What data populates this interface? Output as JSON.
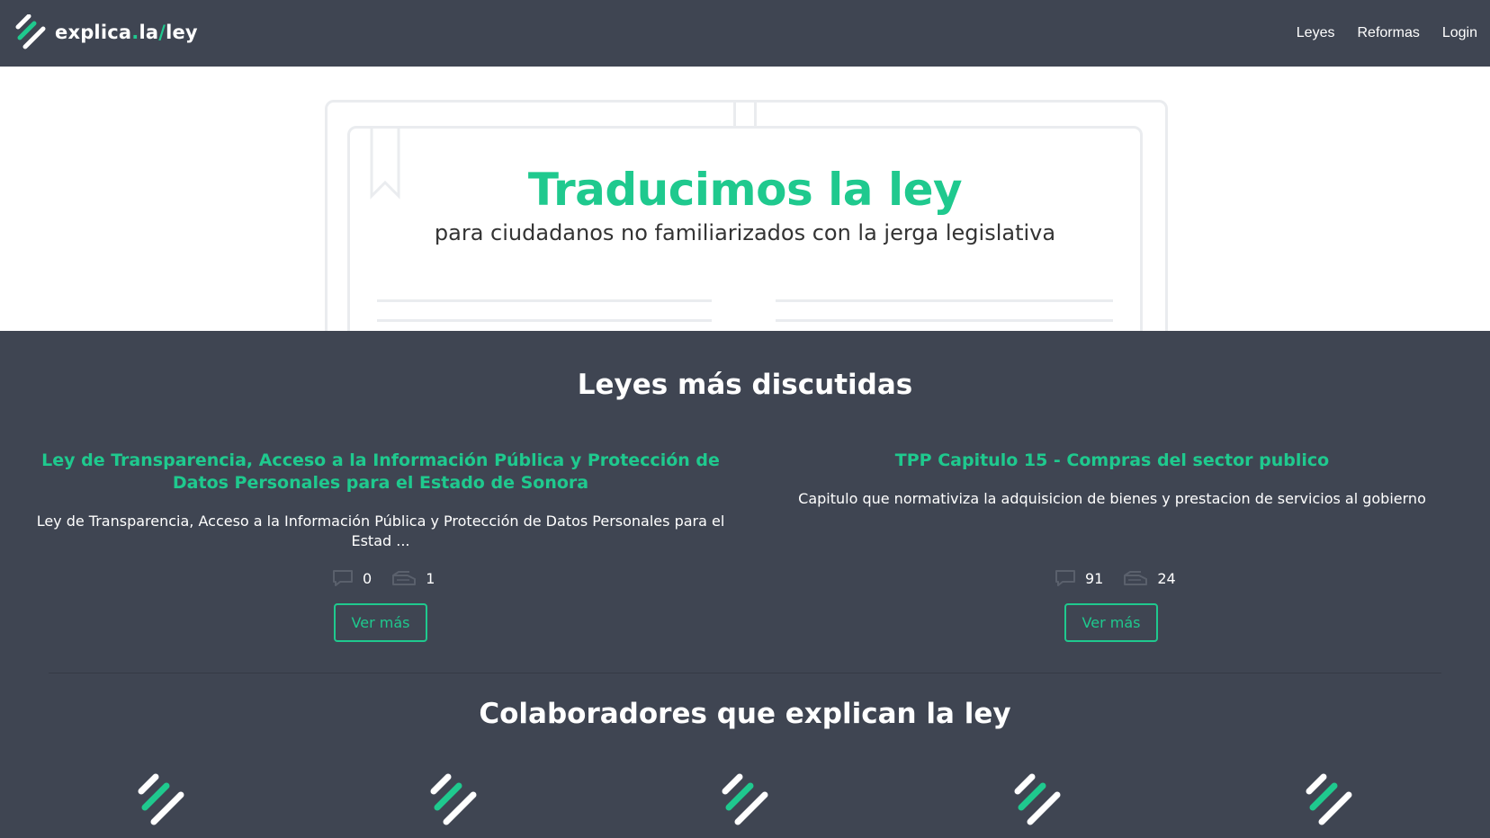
{
  "nav": {
    "brand_part1": "explica",
    "brand_dot": ".",
    "brand_part2": "la",
    "brand_slash": "/",
    "brand_part3": "ley",
    "links": [
      "Leyes",
      "Reformas",
      "Login"
    ]
  },
  "hero": {
    "title": "Traducimos la ley",
    "subtitle": "para ciudadanos no familiarizados con la jerga legislativa"
  },
  "laws_section": {
    "title": "Leyes más discutidas",
    "items": [
      {
        "title": "Ley de Transparencia, Acceso a la Información Pública y Protección de Datos Personales para el Estado de Sonora",
        "description": "Ley de Transparencia, Acceso a la Información Pública y Protección de Datos Personales para el Estad ...",
        "comments": "0",
        "documents": "1",
        "button": "Ver más"
      },
      {
        "title": "TPP Capitulo 15 - Compras del sector publico",
        "description": "Capitulo que normativiza la adquisicion de bienes y prestacion de servicios al gobierno",
        "comments": "91",
        "documents": "24",
        "button": "Ver más"
      }
    ]
  },
  "collaborators_section": {
    "title": "Colaboradores que explican la ley",
    "count": 5
  },
  "colors": {
    "accent": "#1fc98e",
    "dark": "#3f4552",
    "icon_muted": "#5a606c"
  }
}
